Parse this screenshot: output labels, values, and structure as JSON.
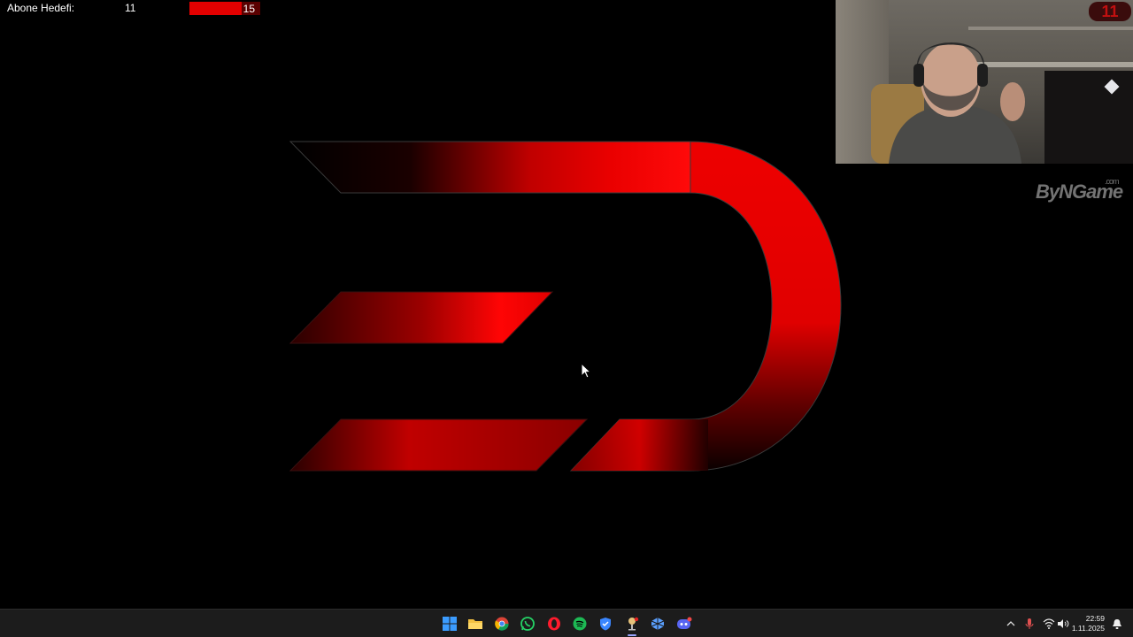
{
  "goal": {
    "label": "Abone Hedefi:",
    "current": "11",
    "target": "15",
    "progress_fraction": 0.733,
    "bar_color": "#e30000"
  },
  "logo": {
    "icon": "dash-d-logo-icon",
    "accent_color": "#e30000"
  },
  "webcam": {
    "badge_text": "11"
  },
  "watermark": {
    "text": "ByNGame",
    "suffix": ".com"
  },
  "taskbar": {
    "apps": [
      {
        "name": "start-button",
        "icon": "windows-icon",
        "color": "#2f8cff"
      },
      {
        "name": "file-explorer",
        "icon": "folder-icon",
        "color": "#f4c242"
      },
      {
        "name": "chrome",
        "icon": "chrome-icon",
        "color": "#db4437"
      },
      {
        "name": "whatsapp",
        "icon": "whatsapp-icon",
        "color": "#25d366"
      },
      {
        "name": "opera",
        "icon": "opera-icon",
        "color": "#ff1b2d"
      },
      {
        "name": "spotify",
        "icon": "spotify-icon",
        "color": "#1db954"
      },
      {
        "name": "shield-app",
        "icon": "shield-icon",
        "color": "#3a86ff"
      },
      {
        "name": "streaming-app",
        "icon": "mic-stand-icon",
        "color": "#e0e0e0"
      },
      {
        "name": "network-app",
        "icon": "cube-icon",
        "color": "#5aa0ff"
      },
      {
        "name": "discord",
        "icon": "discord-icon",
        "color": "#5865f2"
      }
    ],
    "time": "22:59",
    "date": "1.11.2025"
  }
}
